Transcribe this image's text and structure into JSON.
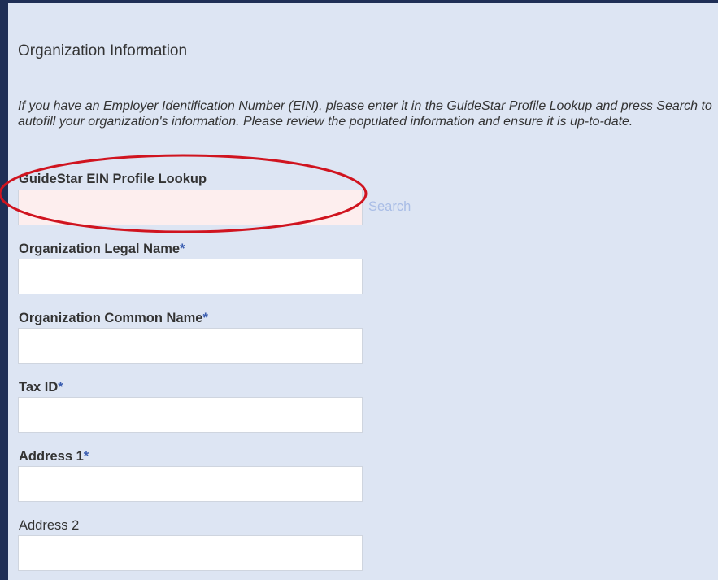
{
  "section": {
    "title": "Organization Information",
    "intro": "If you have an Employer Identification Number (EIN), please enter it in the GuideStar Profile Lookup and press Search to autofill your organization's information. Please review the populated information and ensure it is up-to-date."
  },
  "fields": {
    "ein_lookup": {
      "label": "GuideStar EIN Profile Lookup",
      "value": "",
      "search_label": "Search"
    },
    "legal_name": {
      "label": "Organization Legal Name",
      "required": "*",
      "value": ""
    },
    "common_name": {
      "label": "Organization Common Name",
      "required": "*",
      "value": ""
    },
    "tax_id": {
      "label": "Tax ID",
      "required": "*",
      "value": ""
    },
    "address1": {
      "label": "Address 1",
      "required": "*",
      "value": ""
    },
    "address2": {
      "label": "Address 2",
      "value": ""
    }
  },
  "colors": {
    "frame": "#1f2f56",
    "background": "#dde5f3",
    "required_star": "#3a5db0",
    "search_link": "#a9bde6",
    "annotation_ellipse": "#d0141f"
  }
}
